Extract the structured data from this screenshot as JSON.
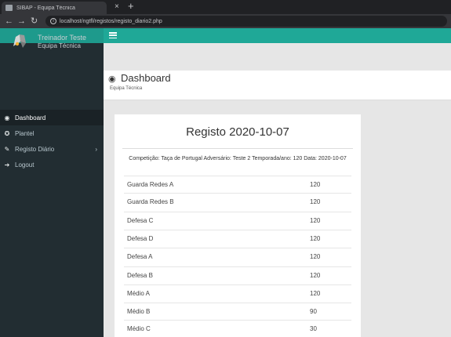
{
  "browser": {
    "tab_title": "SIBAP - Equipa Técnica",
    "url": "localhost/ngtfl/registos/registo_diario2.php"
  },
  "sidebar": {
    "user_name": "Treinador Teste",
    "user_role": "Equipa Técnica",
    "items": [
      {
        "label": "Dashboard",
        "icon": "dashboard-icon"
      },
      {
        "label": "Plantel",
        "icon": "users-icon"
      },
      {
        "label": "Registo Diário",
        "icon": "edit-icon"
      },
      {
        "label": "Logout",
        "icon": "logout-icon"
      }
    ]
  },
  "header": {
    "title": "Dashboard",
    "subtitle": "Equipa Técnica"
  },
  "card": {
    "title": "Registo 2020-10-07",
    "competition": "Competição: Taça de Portugal Adversário: Teste 2 Temporada/ano: 120 Data: 2020-10-07",
    "rows": [
      {
        "label": "Guarda Redes A",
        "value": "120"
      },
      {
        "label": "Guarda Redes B",
        "value": "120"
      },
      {
        "label": "Defesa C",
        "value": "120"
      },
      {
        "label": "Defesa D",
        "value": "120"
      },
      {
        "label": "Defesa A",
        "value": "120"
      },
      {
        "label": "Defesa B",
        "value": "120"
      },
      {
        "label": "Médio A",
        "value": "120"
      },
      {
        "label": "Médio B",
        "value": "90"
      },
      {
        "label": "Médio C",
        "value": "30"
      }
    ]
  },
  "colors": {
    "topbar": "#1fa897",
    "sidebar": "#222d32"
  }
}
